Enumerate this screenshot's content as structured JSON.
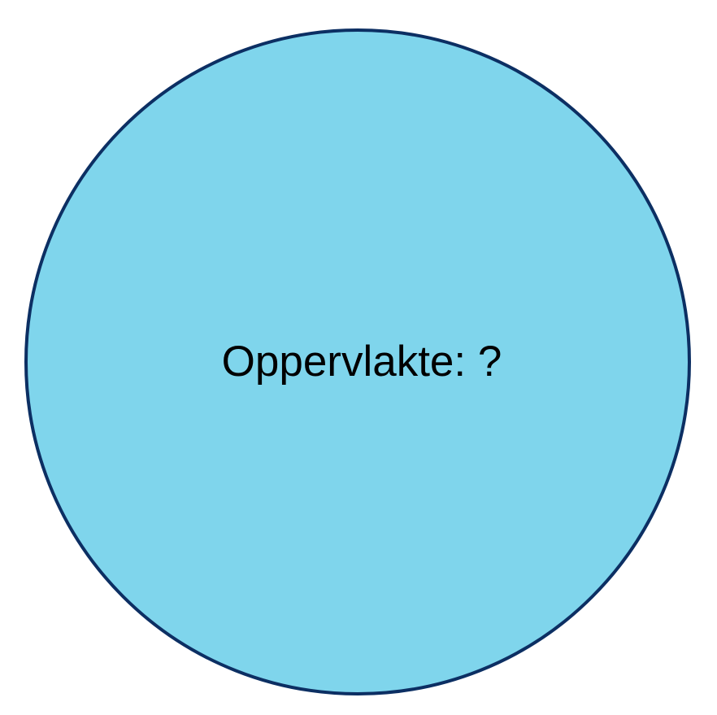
{
  "diagram": {
    "label": "Oppervlakte: ?"
  },
  "colors": {
    "circle_fill": "#7fd5ec",
    "circle_stroke": "#0c2f63",
    "text": "#000000"
  }
}
